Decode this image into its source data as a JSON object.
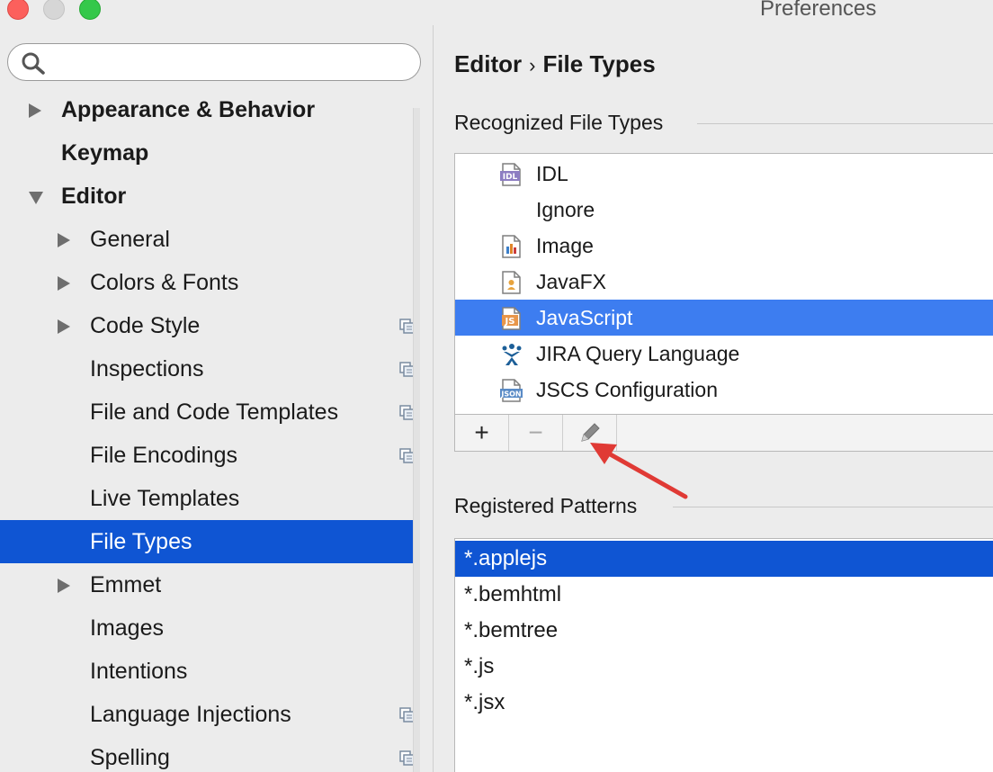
{
  "window": {
    "title": "Preferences"
  },
  "search": {
    "placeholder": "",
    "value": ""
  },
  "sidebar": {
    "items": [
      {
        "label": "Appearance & Behavior",
        "level": 0,
        "expander": "right",
        "bold": true,
        "project_icon": false,
        "selected": false
      },
      {
        "label": "Keymap",
        "level": 0,
        "expander": "none",
        "bold": true,
        "project_icon": false,
        "selected": false
      },
      {
        "label": "Editor",
        "level": 0,
        "expander": "down",
        "bold": true,
        "project_icon": false,
        "selected": false
      },
      {
        "label": "General",
        "level": 1,
        "expander": "right",
        "bold": false,
        "project_icon": false,
        "selected": false
      },
      {
        "label": "Colors & Fonts",
        "level": 1,
        "expander": "right",
        "bold": false,
        "project_icon": false,
        "selected": false
      },
      {
        "label": "Code Style",
        "level": 1,
        "expander": "right",
        "bold": false,
        "project_icon": true,
        "selected": false
      },
      {
        "label": "Inspections",
        "level": 1,
        "expander": "none",
        "bold": false,
        "project_icon": true,
        "selected": false
      },
      {
        "label": "File and Code Templates",
        "level": 1,
        "expander": "none",
        "bold": false,
        "project_icon": true,
        "selected": false
      },
      {
        "label": "File Encodings",
        "level": 1,
        "expander": "none",
        "bold": false,
        "project_icon": true,
        "selected": false
      },
      {
        "label": "Live Templates",
        "level": 1,
        "expander": "none",
        "bold": false,
        "project_icon": false,
        "selected": false
      },
      {
        "label": "File Types",
        "level": 1,
        "expander": "none",
        "bold": false,
        "project_icon": false,
        "selected": true
      },
      {
        "label": "Emmet",
        "level": 1,
        "expander": "right",
        "bold": false,
        "project_icon": false,
        "selected": false
      },
      {
        "label": "Images",
        "level": 1,
        "expander": "none",
        "bold": false,
        "project_icon": false,
        "selected": false
      },
      {
        "label": "Intentions",
        "level": 1,
        "expander": "none",
        "bold": false,
        "project_icon": false,
        "selected": false
      },
      {
        "label": "Language Injections",
        "level": 1,
        "expander": "none",
        "bold": false,
        "project_icon": true,
        "selected": false
      },
      {
        "label": "Spelling",
        "level": 1,
        "expander": "none",
        "bold": false,
        "project_icon": true,
        "selected": false
      }
    ]
  },
  "breadcrumb": {
    "parent": "Editor",
    "separator": "›",
    "current": "File Types"
  },
  "recognized": {
    "title": "Recognized File Types",
    "items": [
      {
        "label": "IDL",
        "icon": "idl-file-icon",
        "badge": "IDL",
        "selected": false
      },
      {
        "label": "Ignore",
        "icon": "none",
        "badge": "",
        "selected": false
      },
      {
        "label": "Image",
        "icon": "image-file-icon",
        "badge": "",
        "selected": false
      },
      {
        "label": "JavaFX",
        "icon": "javafx-file-icon",
        "badge": "",
        "selected": false
      },
      {
        "label": "JavaScript",
        "icon": "javascript-file-icon",
        "badge": "JS",
        "selected": true
      },
      {
        "label": "JIRA Query Language",
        "icon": "jira-icon",
        "badge": "",
        "selected": false
      },
      {
        "label": "JSCS Configuration",
        "icon": "json-file-icon",
        "badge": "JSON",
        "selected": false
      }
    ],
    "toolbar": {
      "add": "+",
      "remove": "−"
    }
  },
  "patterns": {
    "title": "Registered Patterns",
    "items": [
      "*.applejs",
      "*.bemhtml",
      "*.bemtree",
      "*.js",
      "*.jsx"
    ],
    "selected_index": 0
  },
  "colors": {
    "selection": "#0f55d3",
    "selection_light": "#3d7df0",
    "annotation_arrow": "#e03a35"
  }
}
